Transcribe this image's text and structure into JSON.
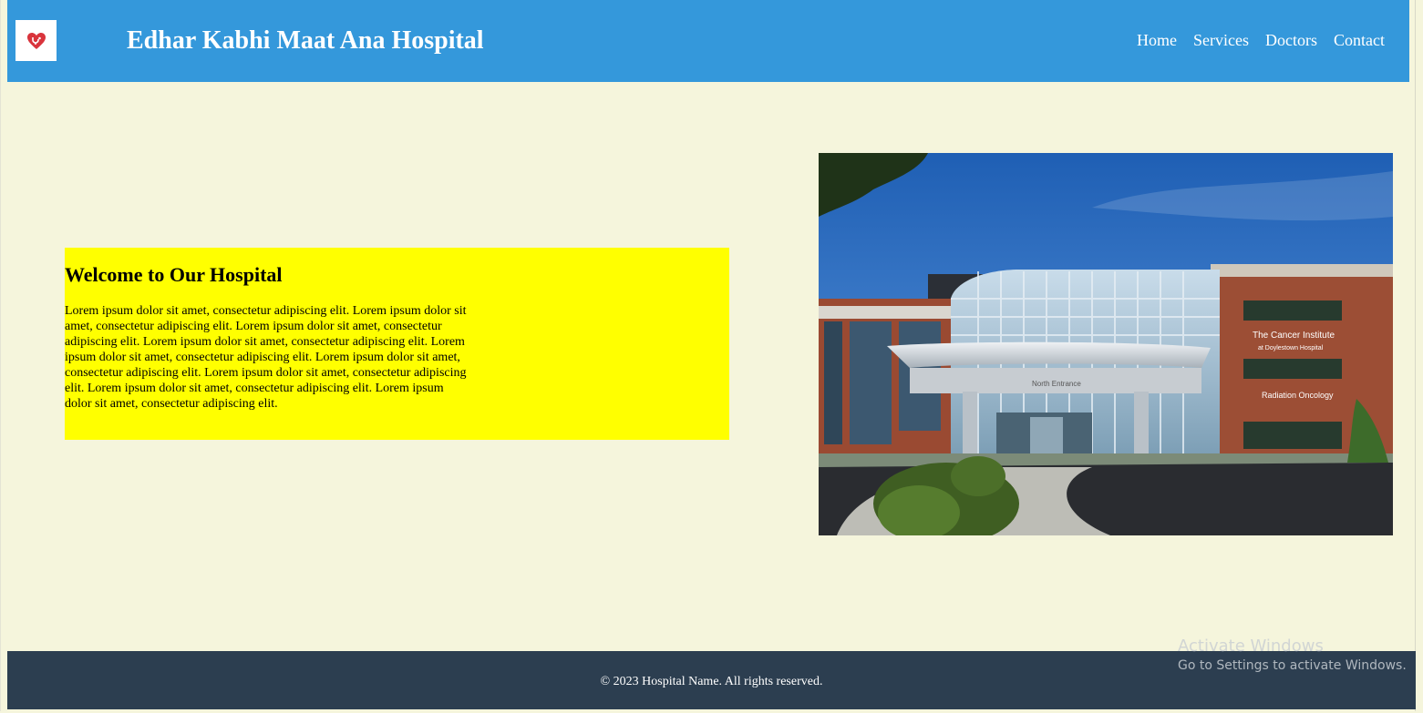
{
  "header": {
    "title": "Edhar Kabhi Maat Ana Hospital",
    "logo_icon": "heart-stethoscope-icon",
    "nav": [
      {
        "label": "Home"
      },
      {
        "label": "Services"
      },
      {
        "label": "Doctors"
      },
      {
        "label": "Contact"
      }
    ]
  },
  "welcome": {
    "heading": "Welcome to Our Hospital",
    "body": "Lorem ipsum dolor sit amet, consectetur adipiscing elit. Lorem ipsum dolor sit amet, consectetur adipiscing elit. Lorem ipsum dolor sit amet, consectetur adipiscing elit. Lorem ipsum dolor sit amet, consectetur adipiscing elit. Lorem ipsum dolor sit amet, consectetur adipiscing elit. Lorem ipsum dolor sit amet, consectetur adipiscing elit. Lorem ipsum dolor sit amet, consectetur adipiscing elit. Lorem ipsum dolor sit amet, consectetur adipiscing elit. Lorem ipsum dolor sit amet, consectetur adipiscing elit."
  },
  "hero_image": {
    "sign_line1": "The Cancer Institute",
    "sign_line2": "at Doylestown Hospital",
    "sign_line3": "Radiation Oncology",
    "entrance_sign": "North Entrance"
  },
  "footer": {
    "copyright": "© 2023 Hospital Name. All rights reserved."
  },
  "watermark": {
    "title": "Activate Windows",
    "subtitle": "Go to Settings to activate Windows."
  },
  "colors": {
    "header_bg": "#3498db",
    "page_bg": "#f5f5dc",
    "welcome_bg": "#ffff00",
    "footer_bg": "#2c3e50"
  }
}
